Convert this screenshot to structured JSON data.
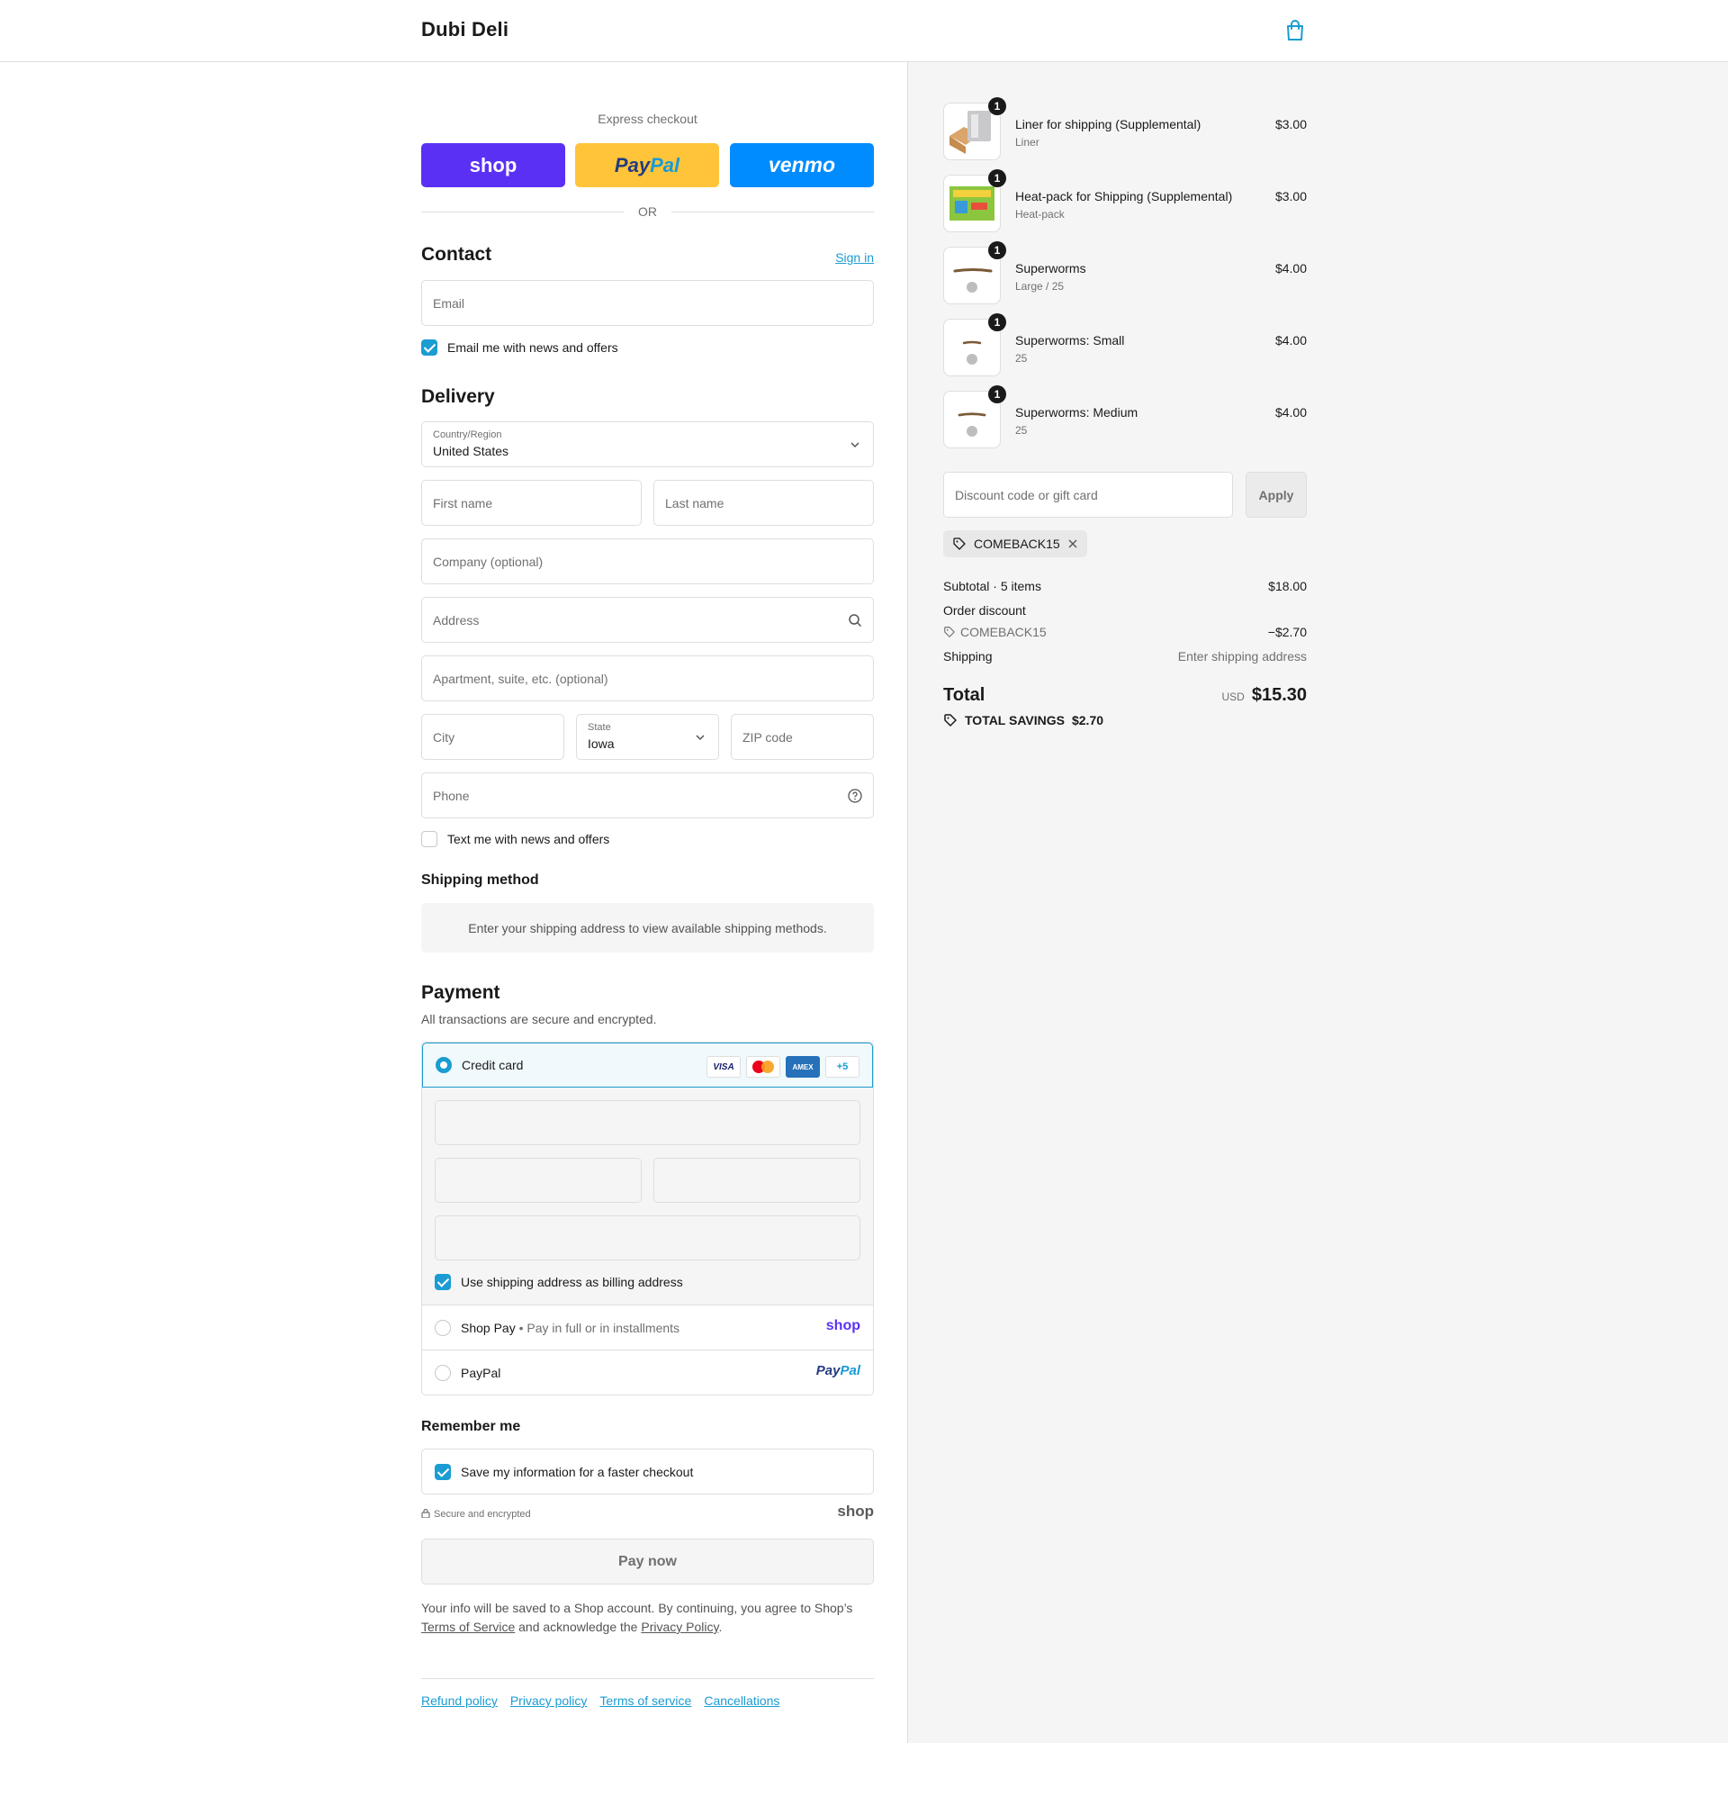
{
  "header": {
    "store_name": "Dubi Deli",
    "cart_icon": "shopping-bag-icon"
  },
  "express": {
    "title": "Express checkout",
    "shop_label": "shop",
    "paypal_label_1": "Pay",
    "paypal_label_2": "Pal",
    "venmo_label": "venmo",
    "divider_text": "OR"
  },
  "contact": {
    "heading": "Contact",
    "sign_in": "Sign in",
    "email_placeholder": "Email",
    "news_label": "Email me with news and offers",
    "news_checked": true
  },
  "delivery": {
    "heading": "Delivery",
    "country_label": "Country/Region",
    "country_value": "United States",
    "first_name": "First name",
    "last_name": "Last name",
    "company": "Company (optional)",
    "address": "Address",
    "apartment": "Apartment, suite, etc. (optional)",
    "city": "City",
    "state_label": "State",
    "state_value": "Iowa",
    "zip": "ZIP code",
    "phone": "Phone",
    "text_label": "Text me with news and offers",
    "text_checked": false
  },
  "shipping_method": {
    "heading": "Shipping method",
    "note": "Enter your shipping address to view available shipping methods."
  },
  "payment": {
    "heading": "Payment",
    "subtitle": "All transactions are secure and encrypted.",
    "credit_card_label": "Credit card",
    "card_brands": [
      "VISA",
      "AMEX",
      "+5"
    ],
    "billing_label": "Use shipping address as billing address",
    "billing_checked": true,
    "shop_pay_label": "Shop Pay",
    "shop_pay_sep": "•",
    "shop_pay_desc": "Pay in full or in installments",
    "shop_pay_brand": "shop",
    "paypal_label": "PayPal",
    "paypal_brand_1": "Pay",
    "paypal_brand_2": "Pal"
  },
  "remember": {
    "heading": "Remember me",
    "save_label": "Save my information for a faster checkout",
    "save_checked": true,
    "secure_text": "Secure and encrypted",
    "shop_mark": "shop"
  },
  "pay_now": "Pay now",
  "legal": {
    "text_1": "Your info will be saved to a Shop account. By continuing, you agree to Shop’s",
    "terms": "Terms of Service",
    "text_2": "and acknowledge the",
    "privacy": "Privacy Policy",
    "text_3": "."
  },
  "footer": {
    "links": [
      "Refund policy",
      "Privacy policy",
      "Terms of service",
      "Cancellations"
    ]
  },
  "order": {
    "items": [
      {
        "name": "Liner for shipping (Supplemental)",
        "variant": "Liner",
        "price": "$3.00",
        "qty": "1"
      },
      {
        "name": "Heat-pack for Shipping (Supplemental)",
        "variant": "Heat-pack",
        "price": "$3.00",
        "qty": "1"
      },
      {
        "name": "Superworms",
        "variant": "Large / 25",
        "price": "$4.00",
        "qty": "1"
      },
      {
        "name": "Superworms: Small",
        "variant": "25",
        "price": "$4.00",
        "qty": "1"
      },
      {
        "name": "Superworms: Medium",
        "variant": "25",
        "price": "$4.00",
        "qty": "1"
      }
    ],
    "discount_placeholder": "Discount code or gift card",
    "apply_label": "Apply",
    "applied_code": "COMEBACK15",
    "subtotal_label": "Subtotal · 5 items",
    "subtotal_value": "$18.00",
    "order_discount_label": "Order discount",
    "discount_code": "COMEBACK15",
    "discount_value": "−$2.70",
    "shipping_label": "Shipping",
    "shipping_value": "Enter shipping address",
    "total_label": "Total",
    "currency": "USD",
    "total_value": "$15.30",
    "savings_label": "TOTAL SAVINGS",
    "savings_value": "$2.70"
  },
  "colors": {
    "accent": "#1b9cd2",
    "shop_purple": "#5a31f4",
    "paypal_yellow": "#ffc439",
    "venmo_blue": "#008cff"
  }
}
